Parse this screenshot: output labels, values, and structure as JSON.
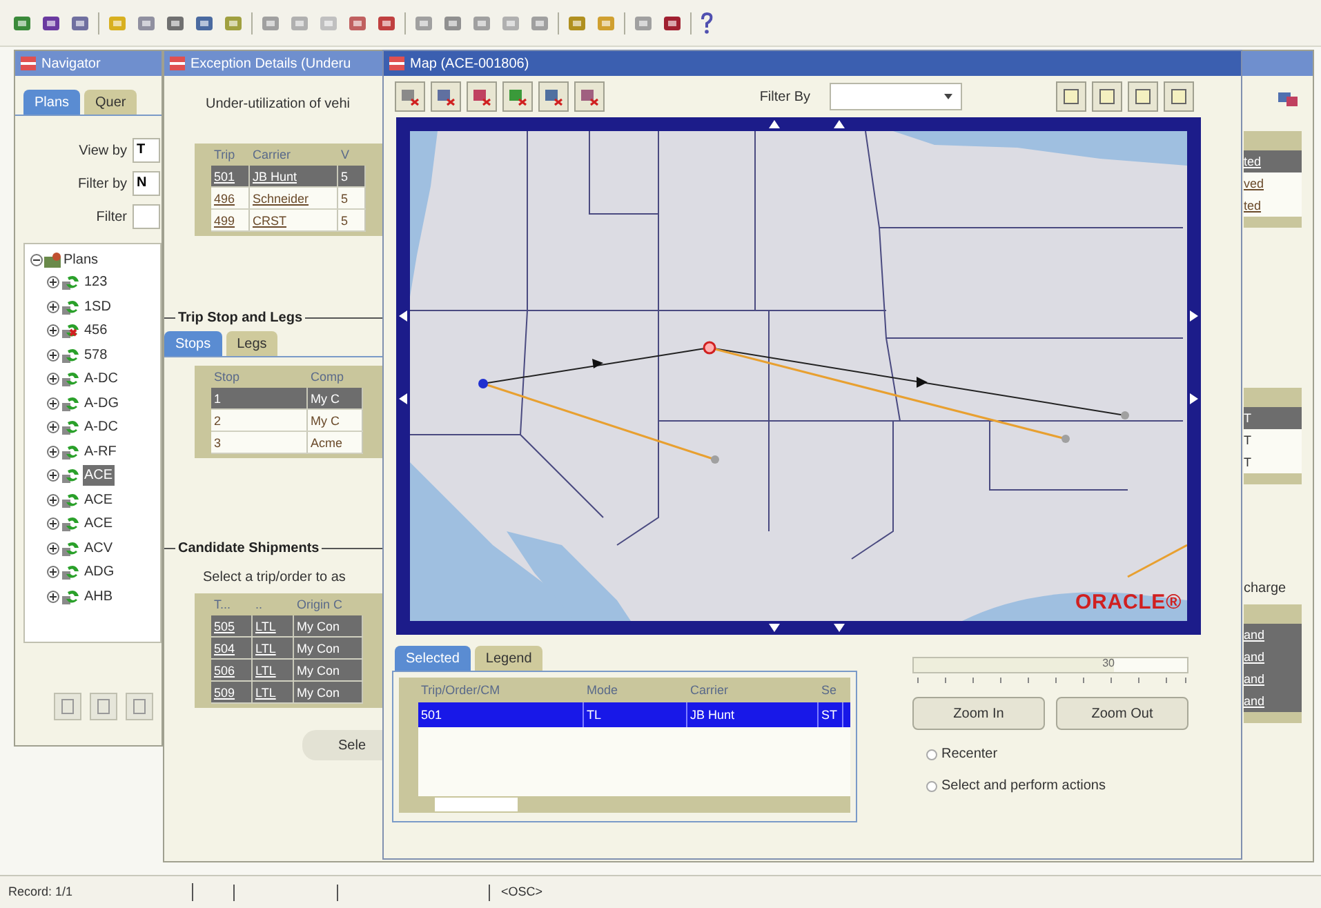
{
  "navigator": {
    "title": "Navigator",
    "tabs": [
      {
        "label": "Plans",
        "selected": true
      },
      {
        "label": "Quer",
        "selected": false
      }
    ],
    "fields": [
      {
        "label": "View by",
        "value": "T"
      },
      {
        "label": "Filter by",
        "value": "N"
      },
      {
        "label": "Filter"
      }
    ],
    "tree": {
      "label": "Plans",
      "expanded": true,
      "children": [
        {
          "label": "123",
          "kind": "plan",
          "selected": false
        },
        {
          "label": "1SD",
          "kind": "plan",
          "selected": false
        },
        {
          "label": "456",
          "kind": "error",
          "selected": false
        },
        {
          "label": "578",
          "kind": "plan",
          "selected": false
        },
        {
          "label": "A-DC",
          "kind": "plan",
          "selected": false
        },
        {
          "label": "A-DG",
          "kind": "plan",
          "selected": false
        },
        {
          "label": "A-DC",
          "kind": "plan",
          "selected": false
        },
        {
          "label": "A-RF",
          "kind": "plan",
          "selected": false
        },
        {
          "label": "ACE",
          "kind": "plan",
          "selected": true
        },
        {
          "label": "ACE",
          "kind": "plan",
          "selected": false
        },
        {
          "label": "ACE",
          "kind": "plan",
          "selected": false
        },
        {
          "label": "ACV",
          "kind": "plan",
          "selected": false
        },
        {
          "label": "ADG",
          "kind": "plan",
          "selected": false
        },
        {
          "label": "AHB",
          "kind": "plan",
          "selected": false
        }
      ]
    }
  },
  "exception": {
    "title": "Exception Details (Underu",
    "description": "Under-utilization of vehi",
    "trips": {
      "columns": [
        "Trip",
        "Carrier",
        "V"
      ],
      "rows": [
        {
          "cells": [
            "501",
            "JB Hunt",
            "5"
          ],
          "selected": true
        },
        {
          "cells": [
            "496",
            "Schneider",
            "5"
          ],
          "selected": false
        },
        {
          "cells": [
            "499",
            "CRST",
            "5"
          ],
          "selected": false
        }
      ],
      "tail": [
        "ted",
        "ved",
        "ted"
      ]
    },
    "stops": {
      "title": "Trip Stop and Legs",
      "tabs": [
        {
          "label": "Stops",
          "selected": true
        },
        {
          "label": "Legs",
          "selected": false
        }
      ],
      "columns": [
        "Stop",
        "Comp"
      ],
      "rows": [
        {
          "cells": [
            "1",
            "My C"
          ],
          "selected": true
        },
        {
          "cells": [
            "2",
            "My C"
          ],
          "selected": false
        },
        {
          "cells": [
            "3",
            "Acme"
          ],
          "selected": false
        }
      ],
      "tail": [
        "T",
        "T",
        "T"
      ]
    },
    "candidates": {
      "title": "Candidate Shipments",
      "instruction": "Select a trip/order to as",
      "instruction_tail": "charge",
      "columns": [
        "T...",
        "..",
        "Origin C"
      ],
      "rows": [
        {
          "cells": [
            "505",
            "LTL",
            "My Con"
          ],
          "selected": true
        },
        {
          "cells": [
            "504",
            "LTL",
            "My Con"
          ],
          "selected": true
        },
        {
          "cells": [
            "506",
            "LTL",
            "My Con"
          ],
          "selected": true
        },
        {
          "cells": [
            "509",
            "LTL",
            "My Con"
          ],
          "selected": true
        }
      ],
      "tail": [
        "and",
        "and",
        "and",
        "and"
      ]
    },
    "button": "Sele"
  },
  "map": {
    "title": "Map (ACE-001806)",
    "filter": {
      "label": "Filter By"
    },
    "logo": "ORACLE®",
    "tabs": [
      {
        "label": "Selected",
        "selected": true
      },
      {
        "label": "Legend",
        "selected": false
      }
    ],
    "table": {
      "columns": [
        "Trip/Order/CM",
        "Mode",
        "Carrier",
        "Se"
      ],
      "rows": [
        {
          "cells": [
            "501",
            "TL",
            "JB Hunt",
            "ST"
          ],
          "selected": true
        }
      ]
    },
    "zoom": {
      "level": 0.73,
      "reading": "30"
    },
    "buttons": [
      "Zoom In",
      "Zoom Out"
    ],
    "options": [
      {
        "label": "Recenter",
        "selected": false
      },
      {
        "label": "Select and perform actions",
        "selected": false
      }
    ]
  },
  "status_bar": [
    "Record: 1/1",
    "<OSC>"
  ]
}
